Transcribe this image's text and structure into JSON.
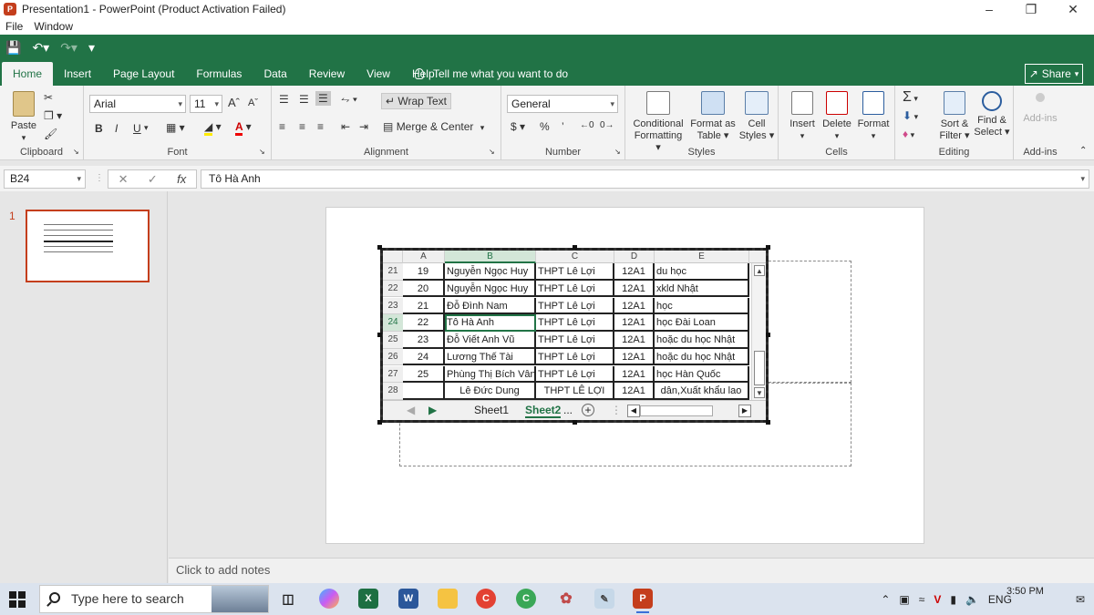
{
  "window": {
    "title": "Presentation1 - PowerPoint (Product Activation Failed)",
    "app_icon": "P"
  },
  "menu": [
    "File",
    "Window"
  ],
  "tabs": [
    "Home",
    "Insert",
    "Page Layout",
    "Formulas",
    "Data",
    "Review",
    "View",
    "Help"
  ],
  "tellme": "Tell me what you want to do",
  "share": "Share",
  "ribbon": {
    "clipboard": {
      "paste": "Paste",
      "label": "Clipboard"
    },
    "font": {
      "name": "Arial",
      "size": "11",
      "bold": "B",
      "italic": "I",
      "underline": "U",
      "label": "Font",
      "grow": "A",
      "shrink": "A"
    },
    "alignment": {
      "wrap": "Wrap Text",
      "merge": "Merge & Center",
      "label": "Alignment"
    },
    "number": {
      "format": "General",
      "currency": "$",
      "percent": "%",
      "comma": "’",
      "label": "Number"
    },
    "styles": {
      "cond": "Conditional",
      "cond2": "Formatting",
      "table": "Format as",
      "table2": "Table",
      "cell": "Cell",
      "cell2": "Styles",
      "label": "Styles"
    },
    "cells": {
      "insert": "Insert",
      "delete": "Delete",
      "format": "Format",
      "label": "Cells"
    },
    "editing": {
      "sort": "Sort &",
      "sort2": "Filter",
      "find": "Find &",
      "find2": "Select",
      "label": "Editing"
    },
    "addins": {
      "btn": "Add-ins",
      "label": "Add-ins"
    }
  },
  "formula": {
    "namebox": "B24",
    "fx": "fx",
    "value": "Tô Hà Anh"
  },
  "thumbnail": {
    "number": "1"
  },
  "notes": "Click to add notes",
  "sheet": {
    "columns": [
      "A",
      "B",
      "C",
      "D",
      "E"
    ],
    "rows": [
      {
        "num": "21",
        "a": "19",
        "b": "Nguyễn Ngọc Huy",
        "c": "THPT Lê Lợi",
        "d": "12A1",
        "e": "du học"
      },
      {
        "num": "22",
        "a": "20",
        "b": "Nguyễn Ngọc Huy",
        "c": "THPT Lê Lợi",
        "d": "12A1",
        "e": "xkld Nhật"
      },
      {
        "num": "23",
        "a": "21",
        "b": "Đỗ Đình Nam",
        "c": "THPT Lê Lợi",
        "d": "12A1",
        "e": "học"
      },
      {
        "num": "24",
        "a": "22",
        "b": "Tô Hà Anh",
        "c": "THPT Lê Lợi",
        "d": "12A1",
        "e": "học Đài Loan"
      },
      {
        "num": "25",
        "a": "23",
        "b": "Đỗ Viết Anh Vũ",
        "c": "THPT Lê Lợi",
        "d": "12A1",
        "e": "hoặc du học Nhật"
      },
      {
        "num": "26",
        "a": "24",
        "b": "Lương Thế Tài",
        "c": "THPT Lê Lợi",
        "d": "12A1",
        "e": "hoặc du học Nhật"
      },
      {
        "num": "27",
        "a": "25",
        "b": "Phùng Thị Bích Vân",
        "c": "THPT Lê Lợi",
        "d": "12A1",
        "e": "học Hàn Quốc"
      },
      {
        "num": "28",
        "a": "",
        "b": "Lê Đức Dung",
        "c": "THPT LÊ LỢI",
        "d": "12A1",
        "e": "dân,Xuất khẩu lao"
      }
    ],
    "tabs": [
      "Sheet1",
      "Sheet2",
      "..."
    ]
  },
  "taskbar": {
    "search_placeholder": "Type here to search",
    "lang": "ENG",
    "time": "3:50 PM"
  },
  "colors": {
    "excel_green": "#217346",
    "ppt_orange": "#c43e1c"
  }
}
